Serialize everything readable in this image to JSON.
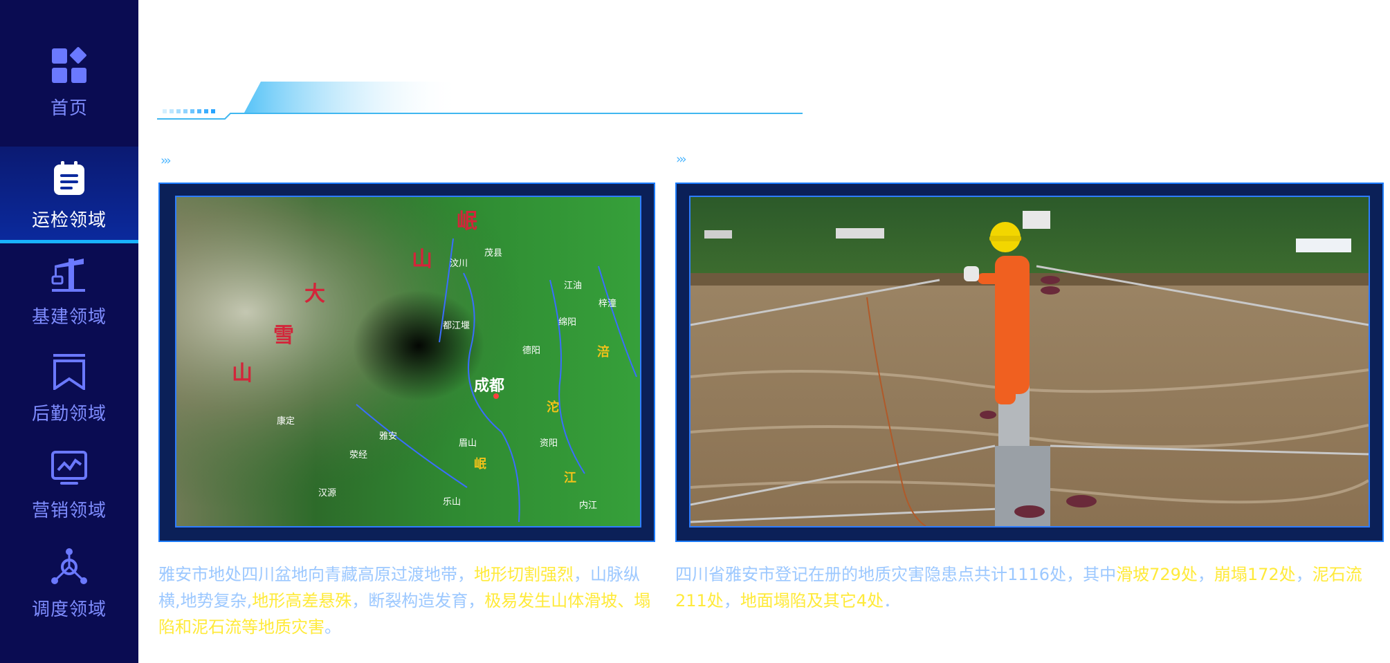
{
  "sidebar": {
    "items": [
      {
        "label": "首页",
        "icon": "home-grid-icon"
      },
      {
        "label": "运检领域",
        "icon": "clipboard-icon"
      },
      {
        "label": "基建领域",
        "icon": "crane-icon"
      },
      {
        "label": "后勤领域",
        "icon": "bookmark-icon"
      },
      {
        "label": "营销领域",
        "icon": "monitor-chart-icon"
      },
      {
        "label": "调度领域",
        "icon": "network-hub-icon"
      }
    ],
    "active_index": 1
  },
  "panels": [
    {
      "image": "sichuan-terrain-map",
      "map_labels": {
        "mountain_1": "大",
        "mountain_2": "雪",
        "mountain_3": "山",
        "mountain_4": "岷",
        "mountain_5": "山",
        "city_chengdu": "成都",
        "city_wenchuan": "汶川",
        "city_maoxian": "茂县",
        "city_jiangyou": "江油",
        "city_zitong": "梓潼",
        "city_mianyang": "绵阳",
        "city_dujiangyan": "都江堰",
        "city_deyang": "德阳",
        "city_kangding": "康定",
        "city_yaan": "雅安",
        "city_yingjing": "荥经",
        "city_meishan": "眉山",
        "city_ziyang": "资阳",
        "city_hanyuan": "汉源",
        "city_leshan": "乐山",
        "city_neijiang": "内江",
        "river_fu": "涪",
        "river_tuo": "沱",
        "river_jiang": "江",
        "river_min": "岷"
      },
      "caption": [
        {
          "text": "雅安市地处四川盆地向青藏高原过渡地带，",
          "hl": false
        },
        {
          "text": "地形切割强烈",
          "hl": true
        },
        {
          "text": "，山脉纵横,地势复杂,",
          "hl": false
        },
        {
          "text": "地形高差悬殊",
          "hl": true
        },
        {
          "text": "，断裂构造发育，",
          "hl": false
        },
        {
          "text": "极易发生山体滑坡、塌陷和泥石流等地质灾害",
          "hl": true
        },
        {
          "text": "。",
          "hl": false
        }
      ]
    },
    {
      "image": "power-worker-on-pole-over-flooded-river",
      "caption": [
        {
          "text": "四川省雅安市登记在册的地质灾害隐患点共计1116处，其中",
          "hl": false
        },
        {
          "text": "滑坡729处",
          "hl": true
        },
        {
          "text": "，",
          "hl": false
        },
        {
          "text": "崩塌172处",
          "hl": true
        },
        {
          "text": "，",
          "hl": false
        },
        {
          "text": "泥石流211处",
          "hl": true
        },
        {
          "text": "，",
          "hl": false
        },
        {
          "text": "地面塌陷及其它4处",
          "hl": true
        },
        {
          "text": "．",
          "hl": false
        }
      ]
    }
  ],
  "colors": {
    "sidebar_bg": "#0a0c52",
    "accent": "#19b3ff",
    "nav_text": "#7f8dff",
    "caption_text": "#9cc8ff",
    "caption_highlight": "#ffea3a"
  }
}
